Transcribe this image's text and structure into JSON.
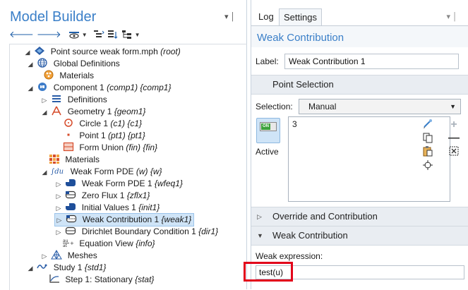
{
  "model_builder": {
    "title": "Model Builder",
    "pin": "▾ │",
    "tree": [
      {
        "label": "Point source weak form.mph",
        "tag": "(root)"
      },
      {
        "label": "Global Definitions",
        "tag": ""
      },
      {
        "label": "Materials",
        "tag": ""
      },
      {
        "label": "Component 1",
        "tag": "(comp1) {comp1}"
      },
      {
        "label": "Definitions",
        "tag": ""
      },
      {
        "label": "Geometry 1",
        "tag": "{geom1}"
      },
      {
        "label": "Circle 1",
        "tag": "(c1) {c1}"
      },
      {
        "label": "Point 1",
        "tag": "(pt1) {pt1}"
      },
      {
        "label": "Form Union",
        "tag": "(fin) {fin}"
      },
      {
        "label": "Materials",
        "tag": ""
      },
      {
        "label": "Weak Form PDE",
        "tag": "(w) {w}"
      },
      {
        "label": "Weak Form PDE 1",
        "tag": "{wfeq1}"
      },
      {
        "label": "Zero Flux 1",
        "tag": "{zflx1}"
      },
      {
        "label": "Initial Values 1",
        "tag": "{init1}"
      },
      {
        "label": "Weak Contribution 1",
        "tag": "{weak1}"
      },
      {
        "label": "Dirichlet Boundary Condition 1",
        "tag": "{dir1}"
      },
      {
        "label": "Equation View",
        "tag": "{info}"
      },
      {
        "label": "Meshes",
        "tag": ""
      },
      {
        "label": "Study 1",
        "tag": "{std1}"
      },
      {
        "label": "Step 1: Stationary",
        "tag": "{stat}"
      }
    ]
  },
  "settings": {
    "tabs": {
      "log": "Log",
      "settings": "Settings"
    },
    "node_title": "Weak Contribution",
    "label_label": "Label:",
    "label_value": "Weak Contribution 1",
    "sections": {
      "point_selection": "Point Selection",
      "override": "Override and Contribution",
      "weak_contribution": "Weak Contribution"
    },
    "selection_label": "Selection:",
    "selection_value": "Manual",
    "selection_items": [
      "3"
    ],
    "active_label": "Active",
    "active_switch": "ON",
    "weak_expression_label": "Weak expression:",
    "weak_expression_value": "test(u)"
  },
  "colors": {
    "title_blue": "#3a7fc8",
    "highlight_red": "#e2001a",
    "selected_row": "#cfe4f7"
  }
}
